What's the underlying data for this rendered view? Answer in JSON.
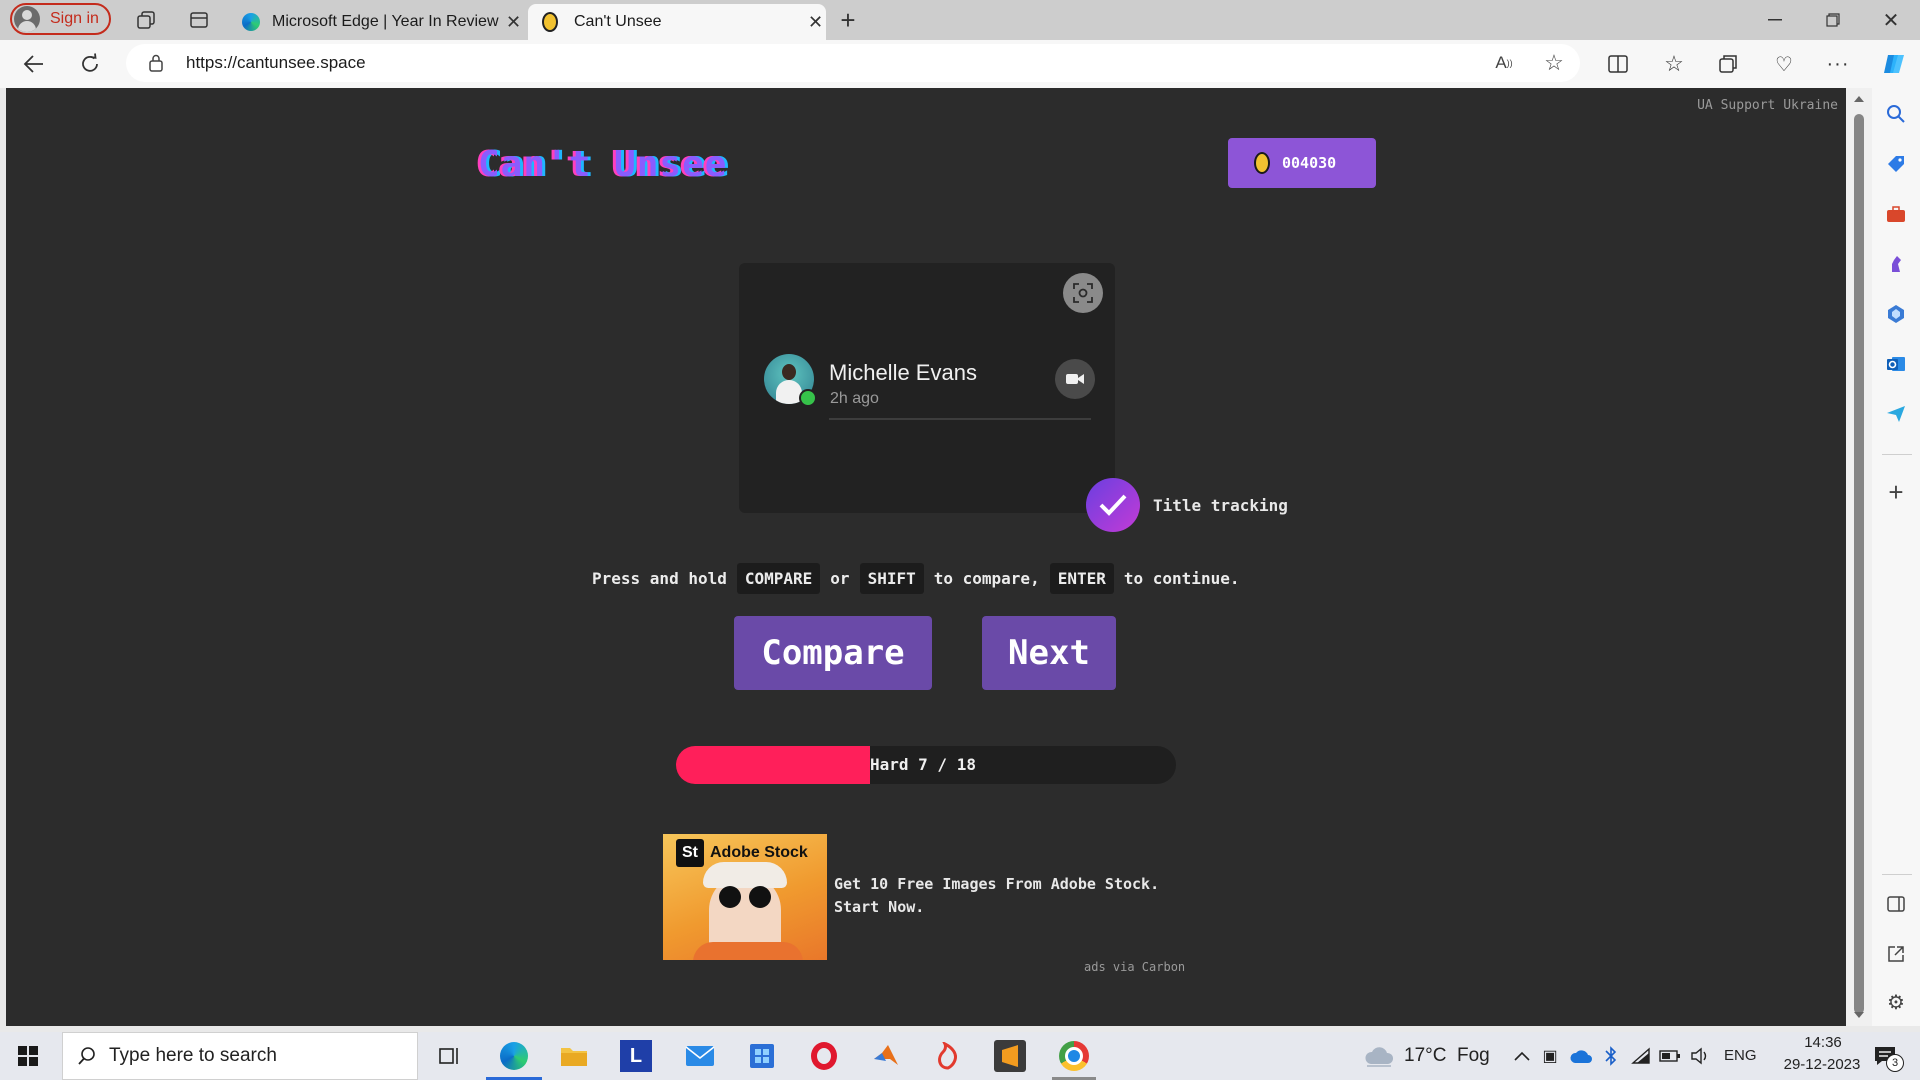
{
  "browser": {
    "profile_label": "Sign in",
    "tabs": [
      {
        "title": "Microsoft Edge | Year In Review"
      },
      {
        "title": "Can't Unsee"
      }
    ],
    "url": "https://cantunsee.space"
  },
  "page": {
    "support_link": "UA Support Ukraine",
    "logo": "Can't Unsee",
    "coins": "004030",
    "card": {
      "name": "Michelle Evans",
      "time": "2h ago"
    },
    "question": "Title tracking",
    "instructions": {
      "part1": "Press and hold",
      "key1": "COMPARE",
      "part2": "or",
      "key2": "SHIFT",
      "part3": "to compare,",
      "key3": "ENTER",
      "part4": "to continue."
    },
    "compare_label": "Compare",
    "next_label": "Next",
    "progress": {
      "label": "Hard 7 / 18",
      "current": 7,
      "total": 18,
      "fill_color": "#ff1f5a"
    },
    "ad": {
      "brand": "Adobe Stock",
      "brand_badge": "St",
      "text": "Get 10 Free Images From Adobe Stock. Start Now.",
      "via": "ads via Carbon"
    },
    "colors": {
      "accent": "#8d55d7",
      "button": "#6a4aa8",
      "background": "#2c2c2c"
    }
  },
  "taskbar": {
    "search_placeholder": "Type here to search",
    "weather": "17°C  Fog",
    "language": "ENG",
    "time": "14:36",
    "date": "29-12-2023",
    "notifications": "3"
  }
}
